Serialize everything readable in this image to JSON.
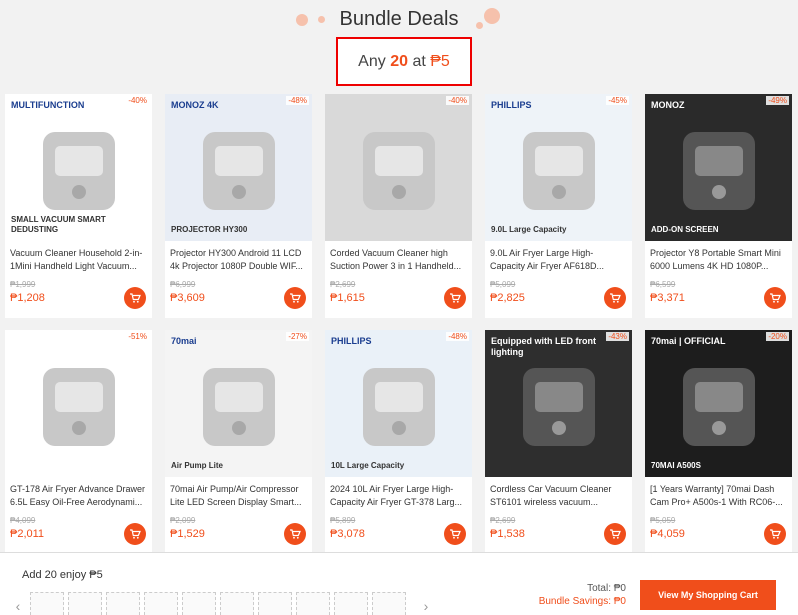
{
  "header": {
    "title": "Bundle Deals",
    "promo": {
      "prefix": "Any",
      "count": "20",
      "mid": "at",
      "price": "₱5"
    }
  },
  "products": [
    {
      "name": "Vacuum Cleaner Household 2-in-1Mini Handheld Light Vacuum...",
      "old": "₱1,999",
      "price": "₱1,208",
      "discount": "-40%",
      "img_text": "MULTIFUNCTION",
      "img_sub": "SMALL VACUUM SMART DEDUSTING",
      "img_bg": "#ffffff"
    },
    {
      "name": "Projector HY300 Android 11 LCD 4k Projector 1080P Double WIF...",
      "old": "₱6,999",
      "price": "₱3,609",
      "discount": "-48%",
      "img_text": "MONOZ 4K",
      "img_sub": "PROJECTOR HY300",
      "img_bg": "#e8edf5"
    },
    {
      "name": "Corded Vacuum Cleaner high Suction Power 3 in 1 Handheld...",
      "old": "₱2,699",
      "price": "₱1,615",
      "discount": "-40%",
      "img_text": "",
      "img_sub": "",
      "img_bg": "#d9d9d9"
    },
    {
      "name": "9.0L Air Fryer Large High-Capacity Air Fryer AF618D...",
      "old": "₱5,099",
      "price": "₱2,825",
      "discount": "-45%",
      "img_text": "PHILLIPS",
      "img_sub": "9.0L Large Capacity",
      "img_bg": "#eef3f8"
    },
    {
      "name": "Projector Y8 Portable Smart Mini 6000 Lumens 4K HD 1080P...",
      "old": "₱6,599",
      "price": "₱3,371",
      "discount": "-49%",
      "img_text": "MONOZ",
      "img_sub": "ADD-ON SCREEN",
      "img_bg": "#2a2a2a"
    },
    {
      "name": "GT-178 Air Fryer Advance Drawer 6.5L Easy Oil-Free Aerodynami...",
      "old": "₱4,099",
      "price": "₱2,011",
      "discount": "-51%",
      "img_text": "",
      "img_sub": "",
      "img_bg": "#ffffff"
    },
    {
      "name": "70mai Air Pump/Air Compressor Lite LED Screen Display Smart...",
      "old": "₱2,099",
      "price": "₱1,529",
      "discount": "-27%",
      "img_text": "70mai",
      "img_sub": "Air Pump Lite",
      "img_bg": "#f4f4f4"
    },
    {
      "name": "2024 10L Air Fryer Large High-Capacity Air Fryer GT-378 Larg...",
      "old": "₱5,899",
      "price": "₱3,078",
      "discount": "-48%",
      "img_text": "PHILLIPS",
      "img_sub": "10L Large Capacity",
      "img_bg": "#eaf1f8"
    },
    {
      "name": "Cordless Car Vacuum Cleaner ST6101 wireless vacuum...",
      "old": "₱2,699",
      "price": "₱1,538",
      "discount": "-43%",
      "img_text": "Equipped with LED front lighting",
      "img_sub": "",
      "img_bg": "#2e2e2e"
    },
    {
      "name": "[1 Years Warranty] 70mai Dash Cam Pro+ A500s-1 With RC06-...",
      "old": "₱5,059",
      "price": "₱4,059",
      "discount": "-20%",
      "img_text": "70mai | OFFICIAL",
      "img_sub": "70MAI A500S",
      "img_bg": "#1d1d1d"
    }
  ],
  "footer": {
    "enjoy": "Add 20 enjoy ₱5",
    "total_label": "Total:",
    "total_value": "₱0",
    "savings_label": "Bundle Savings:",
    "savings_value": "₱0",
    "checkout": "View My Shopping Cart"
  },
  "colors": {
    "accent": "#f04e1b",
    "highlight_box": "#e00000"
  }
}
